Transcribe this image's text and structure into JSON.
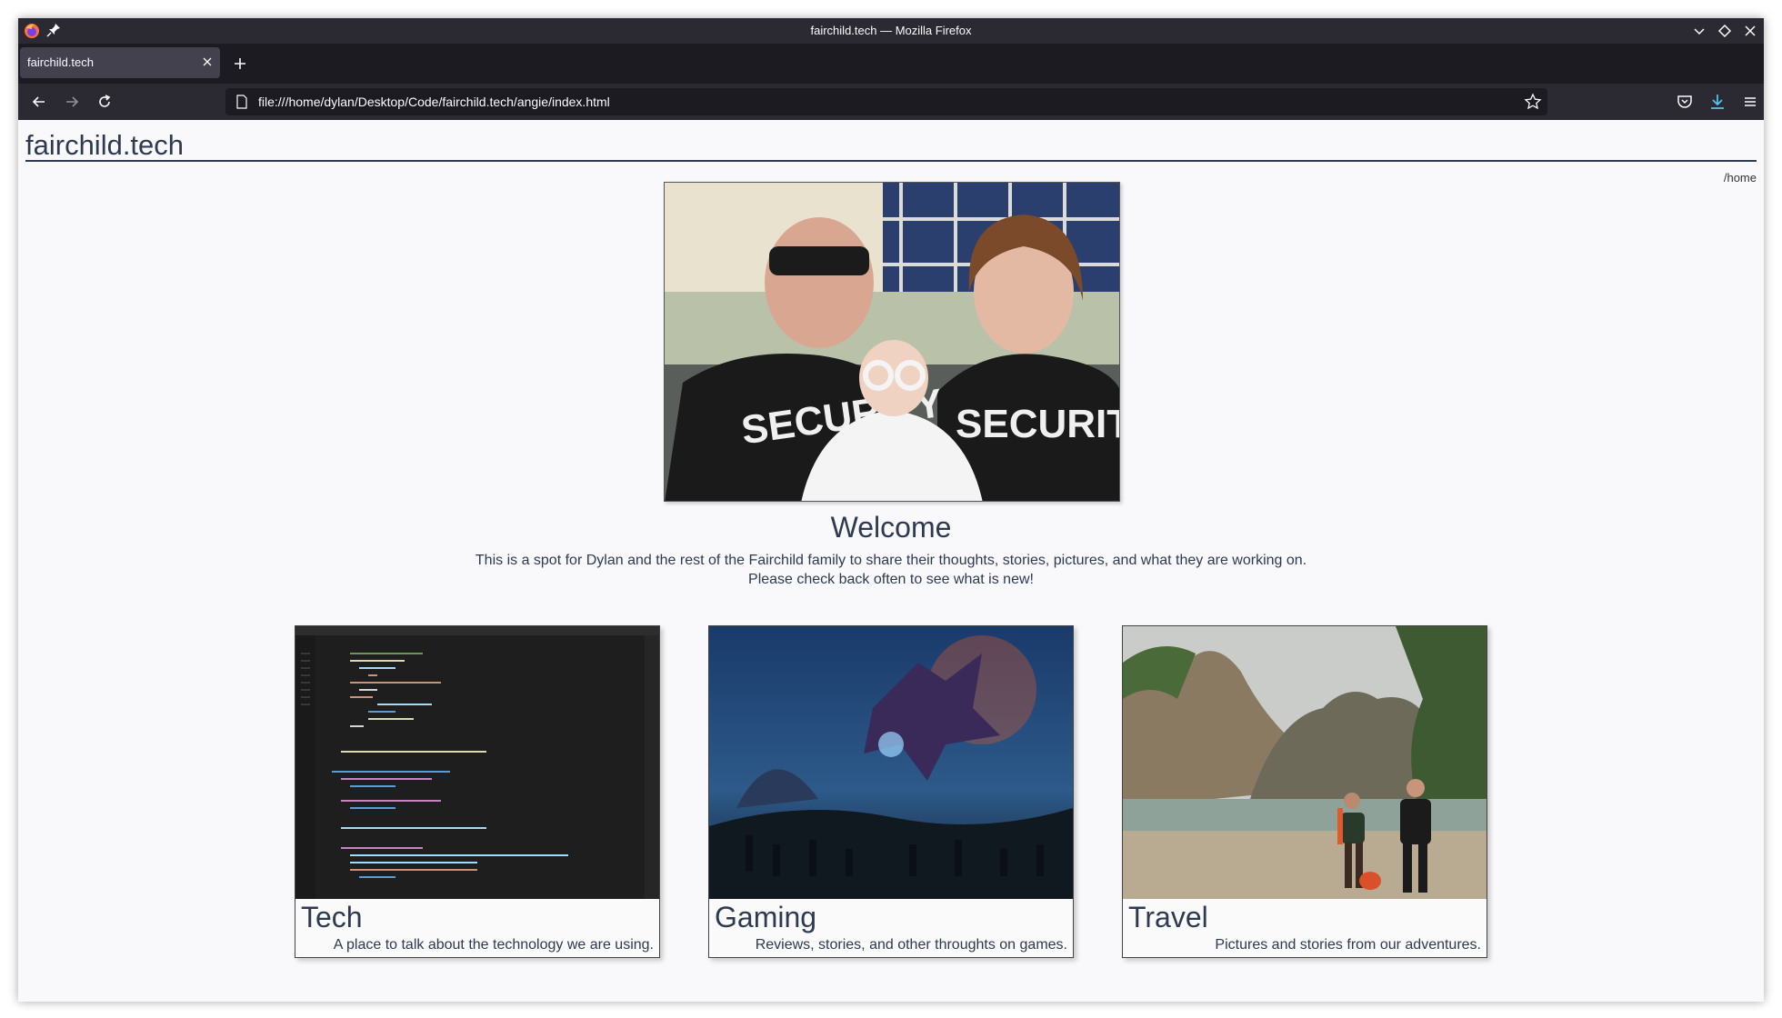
{
  "window": {
    "title": "fairchild.tech — Mozilla Firefox"
  },
  "tabs": [
    {
      "label": "fairchild.tech"
    }
  ],
  "urlbar": {
    "url": "file:///home/dylan/Desktop/Code/fairchild.tech/angie/index.html"
  },
  "site": {
    "title": "fairchild.tech",
    "breadcrumb": "/home",
    "welcome": "Welcome",
    "intro_line1": "This is a spot for Dylan and the rest of the Fairchild family to share their thoughts, stories, pictures, and what they are working on.",
    "intro_line2": "Please check back often to see what is new!"
  },
  "cards": [
    {
      "title": "Tech",
      "description": "A place to talk about the technology we are using."
    },
    {
      "title": "Gaming",
      "description": "Reviews, stories, and other throughts on games."
    },
    {
      "title": "Travel",
      "description": "Pictures and stories from our adventures."
    }
  ],
  "hero_text": {
    "shirt_left": "SECURITY",
    "shirt_right": "SECURITY"
  },
  "colors": {
    "chrome_dark": "#2b2a33",
    "tabstrip": "#1c1b22",
    "active_tab": "#42414d",
    "heading_text": "#2e3a50",
    "download_accent": "#54c5f0"
  }
}
